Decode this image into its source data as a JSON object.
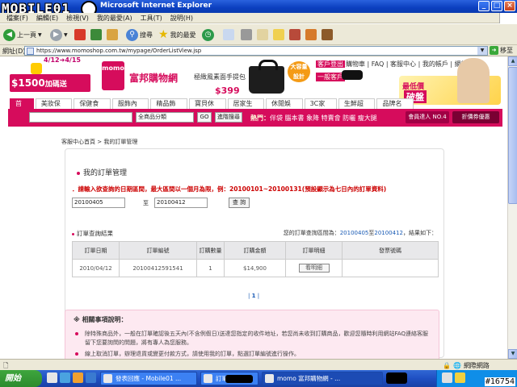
{
  "window": {
    "title": "Microsoft Internet Explorer",
    "watermark_logo": "MOBILE01",
    "controls": [
      "_",
      "□",
      "×"
    ]
  },
  "menu": [
    "檔案(F)",
    "編輯(E)",
    "檢視(V)",
    "我的最愛(A)",
    "工具(T)",
    "說明(H)"
  ],
  "toolbar": {
    "back": "上一頁",
    "search": "搜尋",
    "favorites": "我的最愛"
  },
  "address": {
    "label": "網址(D)",
    "url": "https://www.momoshop.com.tw/mypage/OrderListView.jsp",
    "go": "移至"
  },
  "header": {
    "promo_dates": "4/12➜4/15",
    "promo_amount": "$1500",
    "promo_suffix": "加碼送",
    "logo": "momo",
    "brand": "富邦購物網",
    "ad_title": "極緻風素面手提包",
    "ad_price": "$399",
    "ad_badge": "大容量 設計",
    "vip_label": "客戶登出",
    "member_label": "一般客戶",
    "top_links": "購物車 | FAQ | 客服中心 | 我的帳戶 | 網站地圖",
    "right_ad_1": "最低價",
    "right_ad_2": "破盤"
  },
  "nav_tabs": [
    "首頁",
    "美妝保養",
    "保健食品",
    "服飾內著",
    "精品飾包",
    "寶貝休閒",
    "居家生活",
    "休閒娛樂",
    "3C家電",
    "生鮮超市",
    "品牌名店"
  ],
  "search": {
    "input_value": "",
    "category": "全商品分類",
    "go": "GO",
    "advanced": "進階搜尋",
    "hot_label": "熱門：",
    "hot_keywords": "伴袋 腦本書 象降 特賣會 防曬 瘦大腿",
    "btn_registry": "會員達人 NO.4",
    "btn_coupon": "折價券優惠"
  },
  "breadcrumb": "客服中心首頁 > 我的訂單管理",
  "main": {
    "title": "我的訂單管理",
    "notice": "．請輸入欲查詢的日期區間，最大區間以一個月為限，例：20100101~20100131(預設顯示為七日內的訂單資料)",
    "date_start": "20100405",
    "date_sep": "至",
    "date_end": "20100412",
    "query_button": "查 詢",
    "result_title": "訂單查詢結果",
    "range_prefix": "您的訂單查詢區間為：",
    "range_start": "20100405",
    "range_mid": "至",
    "range_end": "20100412",
    "range_suffix": "，結果如下："
  },
  "order_table": {
    "headers": [
      "訂單日期",
      "訂單編號",
      "訂購數量",
      "訂購金額",
      "訂單明細",
      "發票號碼"
    ],
    "rows": [
      {
        "date": "2010/04/12",
        "order_no": "20100412591541",
        "qty": "1",
        "amount": "$14,900",
        "detail": "看明細",
        "invoice": ""
      }
    ]
  },
  "pager": {
    "left": "|",
    "current": "1",
    "right": "|"
  },
  "notes": {
    "heading": "※ 相關事項說明：",
    "line1": "除特殊商品外，一般在訂單確認後五天內(不含例假日)送達您指定的收件地址，若您尚未收到訂購商品，歡迎您隨時利用網站FAQ連絡客服留下您要詢問的問題，將有專人為您服務。",
    "line2": "線上取消訂單，辦理退貨或變更付款方式，請使用我的訂單，點選訂單編號進行操作。"
  },
  "statusbar": {
    "zone": "網際網路"
  },
  "taskbar": {
    "start": "開始",
    "tasks": [
      "發表回應 - Mobile01 ...",
      "訂單",
      "momo 富邦購物網 - ..."
    ],
    "watermark_id": "#16754"
  }
}
